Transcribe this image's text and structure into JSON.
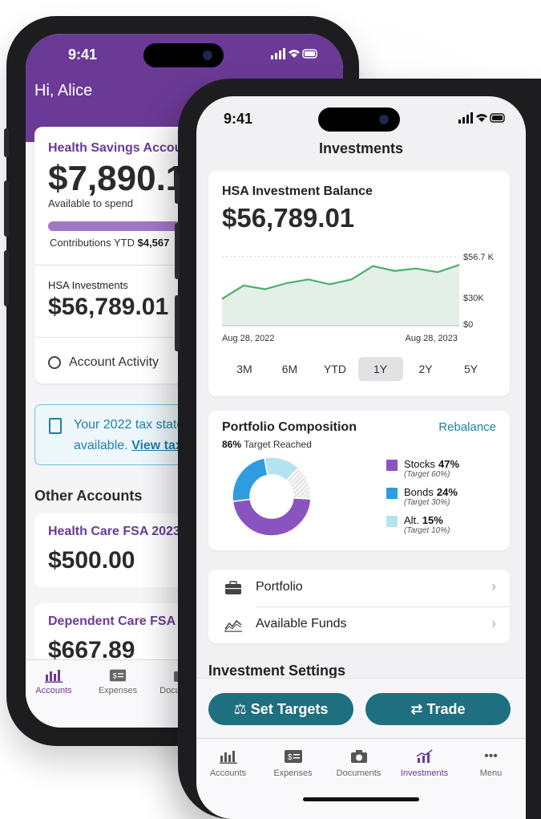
{
  "back": {
    "time": "9:41",
    "status_icons": "signal wifi battery",
    "greeting": "Hi, Alice",
    "hsa_card": {
      "title": "Health Savings Account",
      "balance": "$7,890.12",
      "balance_label": "Available to spend",
      "contrib_label": "Contributions YTD",
      "contrib_value": "$4,567",
      "progress_fraction": 0.55
    },
    "hsa_investments": {
      "label": "HSA Investments",
      "value": "$56,789.01"
    },
    "activity_label": "Account Activity",
    "tax_notice": {
      "text": "Your 2022 tax statement is",
      "text2": "available.",
      "link": "View tax statement"
    },
    "other_accounts_title": "Other Accounts",
    "accounts": [
      {
        "title": "Health Care FSA 2023",
        "value": "$500.00"
      },
      {
        "title": "Dependent Care FSA",
        "value": "$667.89"
      }
    ],
    "tabs": [
      {
        "label": "Accounts",
        "icon": "bar-chart-icon"
      },
      {
        "label": "Expenses",
        "icon": "expense-icon"
      },
      {
        "label": "Documents",
        "icon": "camera-icon"
      }
    ]
  },
  "front": {
    "time": "9:41",
    "screen_title": "Investments",
    "balance_label": "HSA Investment Balance",
    "balance": "$56,789.01",
    "chart_data": {
      "type": "area",
      "x_labels": [
        "Aug 28, 2022",
        "Aug 28, 2023"
      ],
      "y_ticks": [
        "$56.7 K",
        "$30K",
        "$0"
      ],
      "ylim": [
        0,
        56.7
      ],
      "values": [
        22,
        33,
        30,
        35,
        38,
        34,
        38,
        49,
        45,
        47,
        44,
        50
      ],
      "color": "#4caf6b"
    },
    "ranges": [
      "3M",
      "6M",
      "YTD",
      "1Y",
      "2Y",
      "5Y"
    ],
    "selected_range": "1Y",
    "portfolio": {
      "title": "Portfolio Composition",
      "rebalance": "Rebalance",
      "target_pct": "86%",
      "target_text": "Target Reached",
      "slices": [
        {
          "name": "Stocks",
          "pct": "47%",
          "target": "(Target 60%)",
          "value": 47,
          "color": "#8a54c0"
        },
        {
          "name": "Bonds",
          "pct": "24%",
          "target": "(Target 30%)",
          "value": 24,
          "color": "#2f9be0"
        },
        {
          "name": "Alt.",
          "pct": "15%",
          "target": "(Target 10%)",
          "value": 15,
          "color": "#b6e3f0"
        }
      ]
    },
    "list": [
      {
        "label": "Portfolio",
        "icon": "briefcase-icon"
      },
      {
        "label": "Available Funds",
        "icon": "line-chart-icon"
      }
    ],
    "settings_title": "Investment Settings",
    "actions": {
      "set_targets": "Set Targets",
      "trade": "Trade"
    },
    "tabs": [
      {
        "label": "Accounts",
        "icon": "bar-chart-icon"
      },
      {
        "label": "Expenses",
        "icon": "expense-icon"
      },
      {
        "label": "Documents",
        "icon": "camera-icon"
      },
      {
        "label": "Investments",
        "icon": "growth-icon"
      },
      {
        "label": "Menu",
        "icon": "more-icon"
      }
    ],
    "active_tab": "Investments"
  }
}
